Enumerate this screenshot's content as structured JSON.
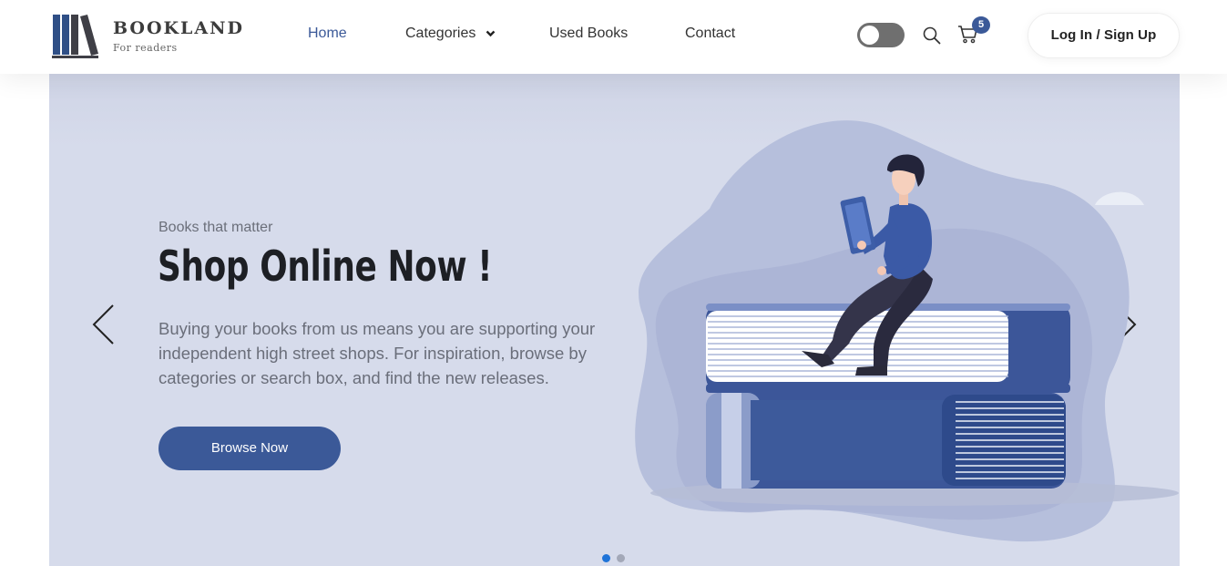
{
  "brand": {
    "name": "BOOKLAND",
    "tagline": "For readers"
  },
  "nav": {
    "items": [
      {
        "label": "Home",
        "active": true
      },
      {
        "label": "Categories",
        "has_dropdown": true
      },
      {
        "label": "Used Books"
      },
      {
        "label": "Contact"
      }
    ]
  },
  "header_actions": {
    "theme_toggle": {
      "state": "off"
    },
    "search_icon": "search-icon",
    "cart_icon": "cart-icon",
    "cart_count": "5",
    "login_label": "Log In / Sign Up"
  },
  "hero": {
    "eyebrow": "Books that matter",
    "headline": "Shop Online Now !",
    "description": "Buying your books from us means you are supporting your independent high street shops. For inspiration, browse by categories or search box, and find the new releases.",
    "cta_label": "Browse Now",
    "prev_icon": "chevron-left-icon",
    "next_icon": "chevron-right-icon",
    "slides": {
      "count": 2,
      "active": 1
    }
  },
  "colors": {
    "accent": "#3b5998",
    "hero_background": "#d6dbeb",
    "active_dot": "#1e73d8",
    "inactive_dot": "#a3a8b8"
  }
}
